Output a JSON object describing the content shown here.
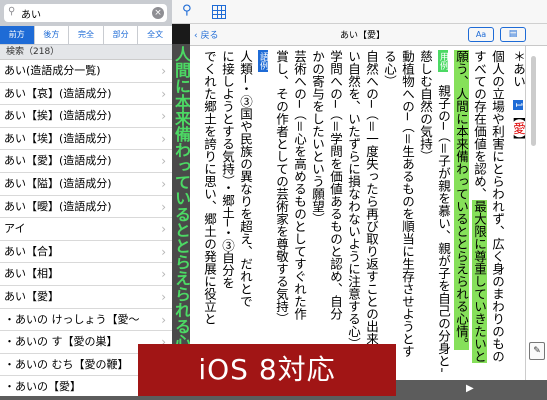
{
  "search": {
    "value": "あい",
    "search_icon": "magnifier-icon",
    "clear_icon": "clear-icon"
  },
  "mode_tabs": [
    "前方",
    "後方",
    "完全",
    "部分",
    "全文"
  ],
  "results_header": "検索（218）",
  "results": [
    "あい(造語成分一覧)",
    "あい【哀】(造語成分)",
    "あい【挨】(造語成分)",
    "あい【埃】(造語成分)",
    "あい【愛】(造語成分)",
    "あい【隘】(造語成分)",
    "あい【曖】(造語成分)",
    "アイ",
    "あい【合】",
    "あい【相】",
    "あい【愛】",
    "・あいの けっしょう【愛～",
    "・あいの す【愛の巣】",
    "・あいの むち【愛の鞭】",
    "・あいの【愛】"
  ],
  "banner_text": "人間に本来備わっているととらえられる心情",
  "toolbar": {
    "back_label": "戻る",
    "title": "あい【愛】",
    "font_button": "Aa",
    "note_button": "▤"
  },
  "entry": {
    "headword_mark": "＊",
    "headword": "あい",
    "sense_num": "1",
    "kanji": "愛",
    "col1": "個人の立場や利害にとらわれず、広く身のまわりのもの",
    "col2": "すべての存在価値を認め、",
    "col2_hl": "最大限に尊重していきたいと",
    "col3_hl": "願う、人間に本来備わっているととらえられる心情。",
    "col4_tag": "用例",
    "col4": "親子の─（＝子が親を慕い、親が子を自己の分身として",
    "col5": "慈しむ自然の気持）",
    "col6": "動植物への─（＝生あるものを順当に生存させようとす",
    "col7": "る心）",
    "col8": "自然への─（＝一度失ったら再び取り返すことの出来な",
    "col9": "い自然を、いたずらに損なわないように注意する心）",
    "col10": "学問への─（＝学問を価値あるものと認め、自分",
    "col11": "かの寄与をしたいという願望）",
    "col12": "芸術への─（＝心を高めるものとしてすぐれた作",
    "col13": "賞し、その作者としての芸術家を尊敬する気持）",
    "col14_tag": "語例",
    "col15": "人類─・③国や民族の異なりを超え、だれとで",
    "col16": "に接しようとする気持）・郷土─・③自分を",
    "col17": "でくれた郷土を誇りに思い、郷土の発展に役立と"
  },
  "memo_label": "✎",
  "bottom": {
    "prev": "◀",
    "next": "▶"
  },
  "badge": "iOS 8対応",
  "colors": {
    "accent": "#1e6bd6",
    "highlight": "#86e05a",
    "badge": "#a11515",
    "banner_text": "#4cd964"
  }
}
